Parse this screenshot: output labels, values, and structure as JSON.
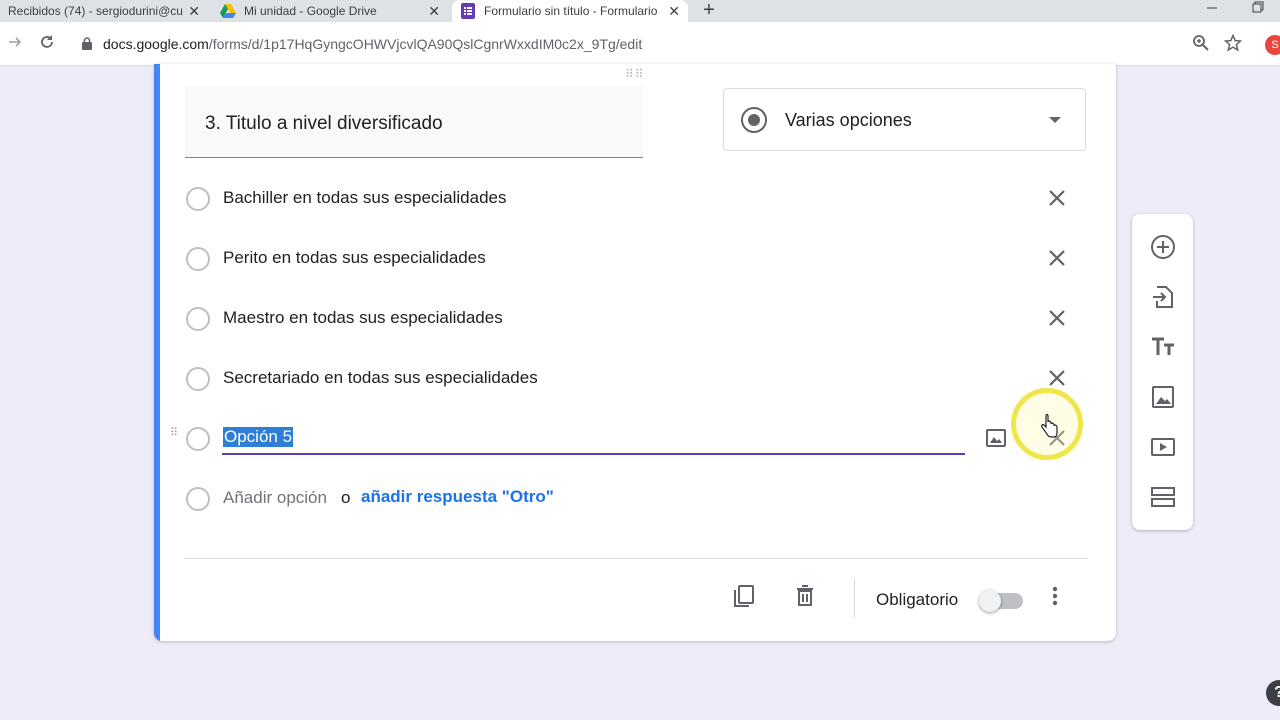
{
  "browser": {
    "tabs": [
      {
        "title": "Recibidos (74) - sergiodurini@cu",
        "active": false
      },
      {
        "title": "Mi unidad - Google Drive",
        "active": false
      },
      {
        "title": "Formulario sin título - Formulario",
        "active": true
      }
    ],
    "close_glyph": "✕",
    "new_tab_glyph": "+",
    "url_host": "docs.google.com",
    "url_path": "/forms/d/1p17HqGyngcOHWVjcvlQA90QslCgnrWxxdIM0c2x_9Tg/edit",
    "profile_initial": "S"
  },
  "question": {
    "title": "3. Titulo a nivel diversificado",
    "type": "Varias opciones",
    "options": [
      "Bachiller en todas sus especialidades",
      "Perito en todas sus especialidades",
      "Maestro en todas sus especialidades",
      "Secretariado en todas sus especialidades",
      "Opción 5"
    ],
    "add_option": "Añadir opción",
    "or": "o",
    "add_other": "añadir respuesta \"Otro\"",
    "required_label": "Obligatorio",
    "required": false
  },
  "sidebar": {
    "items": [
      "add-question",
      "import-questions",
      "add-title",
      "add-image",
      "add-video",
      "add-section"
    ]
  },
  "help_glyph": "?",
  "colors": {
    "accent": "#4285f4",
    "purple": "#673ab7",
    "link": "#1a73e8",
    "background": "#f0ebf8"
  }
}
